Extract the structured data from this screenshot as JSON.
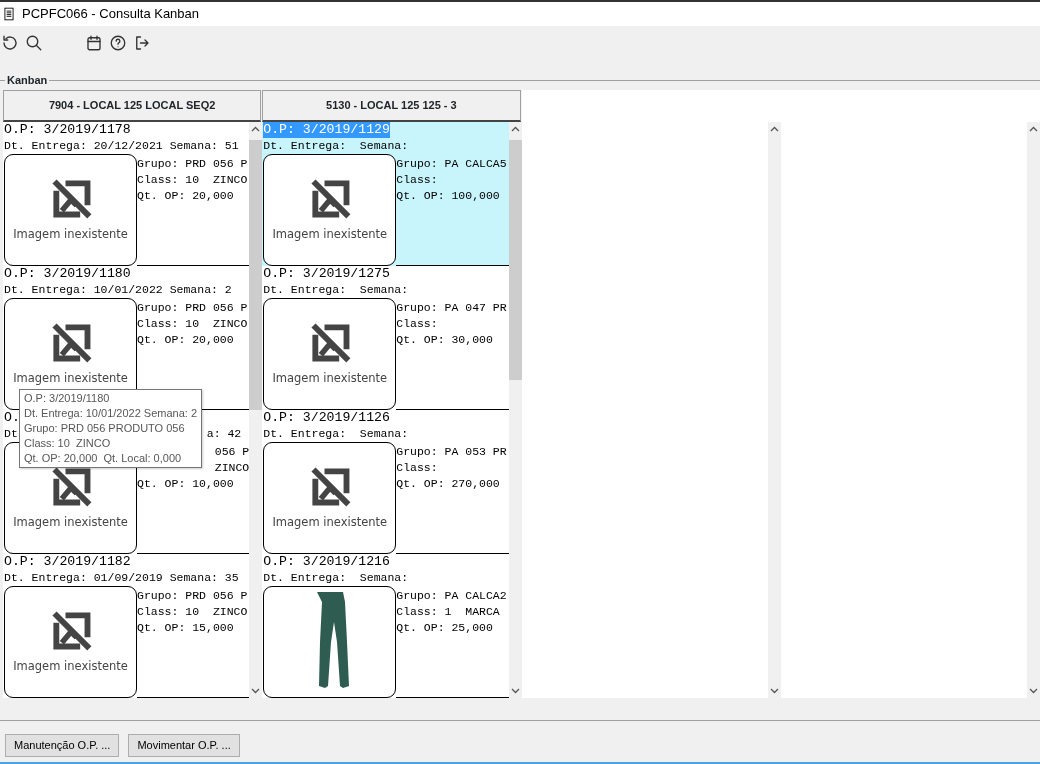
{
  "window": {
    "title": "PCPFC066 - Consulta Kanban"
  },
  "group_label": "Kanban",
  "columns": [
    {
      "header": "7904 - LOCAL 125 LOCAL SEQ2",
      "cards": [
        {
          "kind": "full",
          "selected": false,
          "op": "O.P: 3/2019/1178",
          "delivery": "Dt. Entrega: 20/12/2021 Semana: 51",
          "image": {
            "kind": "missing",
            "caption": "Imagem inexistente"
          },
          "info": [
            {
              "text": "Grupo: PRD 056 P",
              "kind": "left"
            },
            {
              "text": "Class: 10  ZINCO",
              "kind": "left"
            },
            {
              "text": "Qt. OP: 20,000",
              "kind": "left"
            }
          ]
        },
        {
          "kind": "full",
          "selected": false,
          "op": "O.P: 3/2019/1180",
          "delivery": "Dt. Entrega: 10/01/2022 Semana: 2",
          "image": {
            "kind": "missing",
            "caption": "Imagem inexistente"
          },
          "info": [
            {
              "text": "Grupo: PRD 056 P",
              "kind": "left"
            },
            {
              "text": "Class: 10  ZINCO",
              "kind": "left"
            },
            {
              "text": "Qt. OP: 20,000",
              "kind": "left"
            }
          ]
        },
        {
          "kind": "covered",
          "selected": false,
          "op": "O.",
          "delivery": "Dt",
          "delivery_tail": "a: 42",
          "image": {
            "kind": "missing",
            "caption": "Imagem inexistente"
          },
          "info": [
            {
              "text": "056 P",
              "kind": "right"
            },
            {
              "text": "ZINCO",
              "kind": "right"
            },
            {
              "text": "Qt. OP: 10,000",
              "kind": "left"
            }
          ]
        },
        {
          "kind": "full",
          "selected": false,
          "op": "O.P: 3/2019/1182",
          "delivery": "Dt. Entrega: 01/09/2019 Semana: 35",
          "image": {
            "kind": "missing",
            "caption": "Imagem inexistente"
          },
          "info": [
            {
              "text": "Grupo: PRD 056 P",
              "kind": "left"
            },
            {
              "text": "Class: 10  ZINCO",
              "kind": "left"
            },
            {
              "text": "Qt. OP: 15,000",
              "kind": "left"
            }
          ]
        }
      ]
    },
    {
      "header": "5130 - LOCAL 125 125 - 3",
      "cards": [
        {
          "kind": "full",
          "selected": true,
          "op": "O.P: 3/2019/1129",
          "delivery": "Dt. Entrega:  Semana:",
          "image": {
            "kind": "missing",
            "caption": "Imagem inexistente"
          },
          "info": [
            {
              "text": "Grupo: PA CALCA5",
              "kind": "left"
            },
            {
              "text": "Class:",
              "kind": "left"
            },
            {
              "text": "Qt. OP: 100,000",
              "kind": "left"
            }
          ]
        },
        {
          "kind": "full",
          "selected": false,
          "op": "O.P: 3/2019/1275",
          "delivery": "Dt. Entrega:  Semana:",
          "image": {
            "kind": "missing",
            "caption": "Imagem inexistente"
          },
          "info": [
            {
              "text": "Grupo: PA 047 PR",
              "kind": "left"
            },
            {
              "text": "Class:",
              "kind": "left"
            },
            {
              "text": "Qt. OP: 30,000",
              "kind": "left"
            }
          ]
        },
        {
          "kind": "full",
          "selected": false,
          "op": "O.P: 3/2019/1126",
          "delivery": "Dt. Entrega:  Semana:",
          "image": {
            "kind": "missing",
            "caption": "Imagem inexistente"
          },
          "info": [
            {
              "text": "Grupo: PA 053 PR",
              "kind": "left"
            },
            {
              "text": "Class:",
              "kind": "left"
            },
            {
              "text": "Qt. OP: 270,000",
              "kind": "left"
            }
          ]
        },
        {
          "kind": "full",
          "selected": false,
          "op": "O.P: 3/2019/1216",
          "delivery": "Dt. Entrega:  Semana:",
          "image": {
            "kind": "photo"
          },
          "info": [
            {
              "text": "Grupo: PA CALCA2",
              "kind": "left"
            },
            {
              "text": "Class: 1  MARCA",
              "kind": "left"
            },
            {
              "text": "Qt. OP: 25,000",
              "kind": "left"
            }
          ]
        }
      ]
    }
  ],
  "tooltip": {
    "lines": [
      "O.P: 3/2019/1180",
      "Dt. Entrega: 10/01/2022 Semana: 2",
      "Grupo: PRD 056 PRODUTO 056",
      "Class: 10  ZINCO",
      "Qt. OP: 20,000  Qt. Local: 0,000"
    ]
  },
  "buttons": [
    "Manutenção O.P. ...",
    "Movimentar O.P. ..."
  ]
}
